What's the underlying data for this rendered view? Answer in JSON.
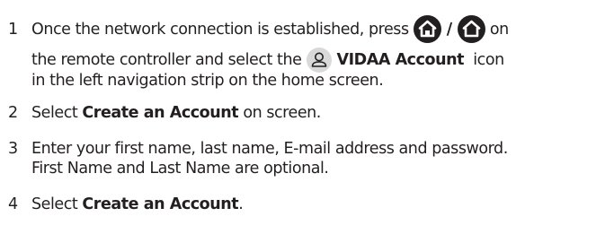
{
  "steps": [
    {
      "num": "1",
      "line1_a": "Once the network connection is established, press ",
      "line1_sep": "/",
      "line1_b": " on",
      "line2_a": "the remote controller and select the ",
      "line2_bold": "VIDAA Account",
      "line2_b": "  icon",
      "line3": "in the left navigation strip on the home screen."
    },
    {
      "num": "2",
      "text_a": "Select ",
      "text_bold": "Create an Account",
      "text_b": " on screen."
    },
    {
      "num": "3",
      "line1": "Enter your first name, last name, E-mail address and password.",
      "line2": "First Name and Last Name are optional."
    },
    {
      "num": "4",
      "text_a": "Select ",
      "text_bold": "Create an Account",
      "text_b": "."
    }
  ],
  "icons": {
    "home": "home-icon",
    "account": "account-icon"
  },
  "colors": {
    "text": "#231f20",
    "icon_dark": "#231f20",
    "icon_light": "#d9d9d9"
  }
}
